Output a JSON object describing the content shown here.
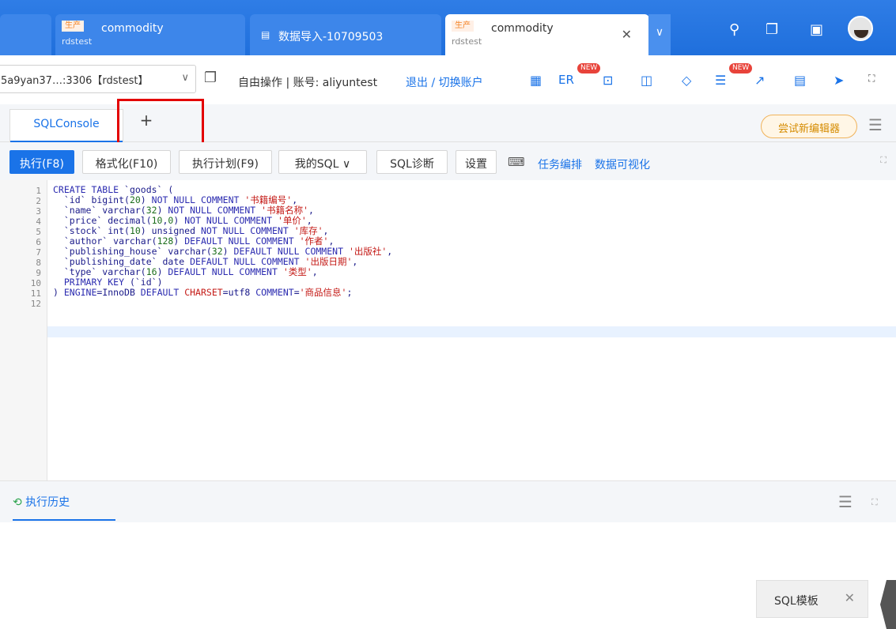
{
  "tabs": [
    {
      "env": "生产",
      "title": "commodity",
      "db": "rdstest"
    },
    {
      "title": "数据导入-10709503"
    },
    {
      "env": "生产",
      "title": "commodity",
      "db": "rdstest"
    }
  ],
  "connection": {
    "label": "5a9yan37…:3306【rdstest】"
  },
  "account": {
    "mode": "自由操作 | 账号: aliyuntest",
    "actions": "退出 / 切换账户"
  },
  "toolbar": {
    "er": "ER",
    "new": "NEW"
  },
  "editor_tabs": {
    "console": "SQLConsole",
    "add": "+",
    "try_new": "尝试新编辑器"
  },
  "actions": {
    "run": "执行(F8)",
    "format": "格式化(F10)",
    "plan": "执行计划(F9)",
    "mysql": "我的SQL",
    "diagnose": "SQL诊断",
    "settings": "设置",
    "task": "任务编排",
    "viz": "数据可视化"
  },
  "code_lines": [
    "1",
    "2",
    "3",
    "4",
    "5",
    "6",
    "7",
    "8",
    "9",
    "10",
    "11",
    "12"
  ],
  "template_panel": {
    "label": "SQL模板"
  },
  "history": {
    "label": "执行历史"
  }
}
